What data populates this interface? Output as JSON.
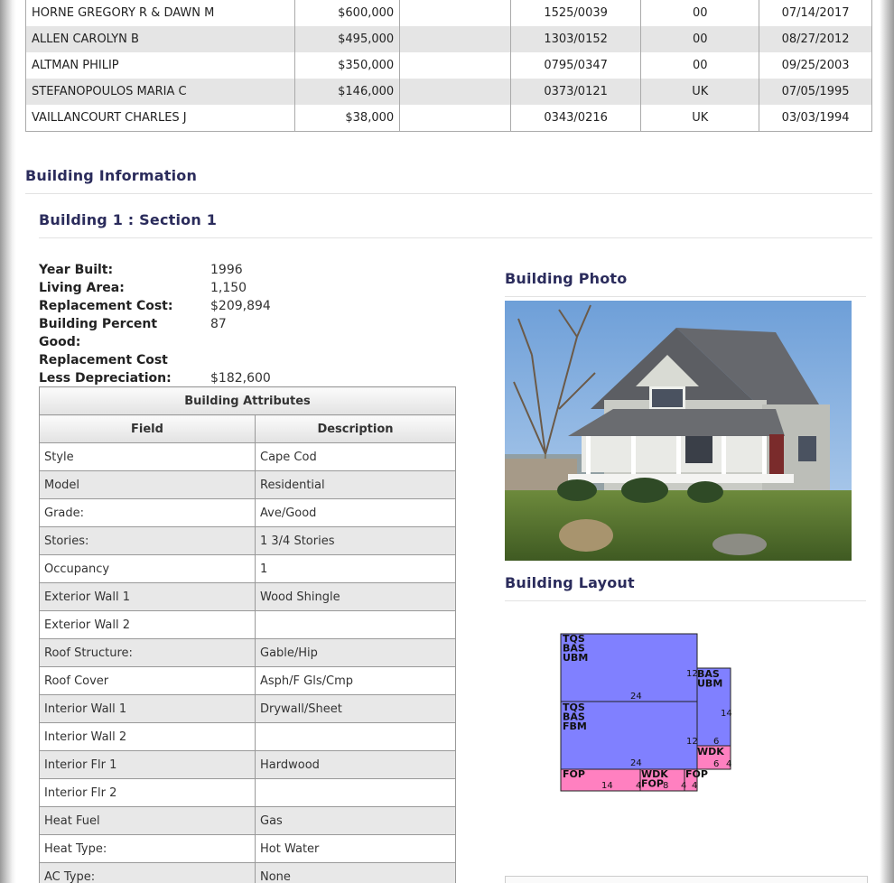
{
  "sales": [
    {
      "owner": "HORNE GREGORY R & DAWN M",
      "price": "$600,000",
      "book_page": "1525/0039",
      "code": "00",
      "date": "07/14/2017"
    },
    {
      "owner": "ALLEN CAROLYN B",
      "price": "$495,000",
      "book_page": "1303/0152",
      "code": "00",
      "date": "08/27/2012"
    },
    {
      "owner": "ALTMAN PHILIP",
      "price": "$350,000",
      "book_page": "0795/0347",
      "code": "00",
      "date": "09/25/2003"
    },
    {
      "owner": "STEFANOPOULOS MARIA C",
      "price": "$146,000",
      "book_page": "0373/0121",
      "code": "UK",
      "date": "07/05/1995"
    },
    {
      "owner": "VAILLANCOURT CHARLES J",
      "price": "$38,000",
      "book_page": "0343/0216",
      "code": "UK",
      "date": "03/03/1994"
    }
  ],
  "building_info": {
    "title": "Building Information",
    "section_title": "Building 1 : Section 1",
    "year_built_label": "Year Built:",
    "year_built": "1996",
    "living_area_label": "Living Area:",
    "living_area": "1,150",
    "replacement_cost_label": "Replacement Cost:",
    "replacement_cost": "$209,894",
    "pct_good_label_1": "Building Percent",
    "pct_good_label_2": "Good:",
    "pct_good": "87",
    "rcld_label_1": "Replacement Cost",
    "rcld_label_2": "Less Depreciation:",
    "rcld": "$182,600"
  },
  "attributes": {
    "title": "Building Attributes",
    "col_field": "Field",
    "col_desc": "Description",
    "rows": [
      {
        "field": "Style",
        "desc": "Cape Cod"
      },
      {
        "field": "Model",
        "desc": "Residential"
      },
      {
        "field": "Grade:",
        "desc": "Ave/Good"
      },
      {
        "field": "Stories:",
        "desc": "1 3/4 Stories"
      },
      {
        "field": "Occupancy",
        "desc": "1"
      },
      {
        "field": "Exterior Wall 1",
        "desc": "Wood Shingle"
      },
      {
        "field": "Exterior Wall 2",
        "desc": ""
      },
      {
        "field": "Roof Structure:",
        "desc": "Gable/Hip"
      },
      {
        "field": "Roof Cover",
        "desc": "Asph/F Gls/Cmp"
      },
      {
        "field": "Interior Wall 1",
        "desc": "Drywall/Sheet"
      },
      {
        "field": "Interior Wall 2",
        "desc": ""
      },
      {
        "field": "Interior Flr 1",
        "desc": "Hardwood"
      },
      {
        "field": "Interior Flr 2",
        "desc": ""
      },
      {
        "field": "Heat Fuel",
        "desc": "Gas"
      },
      {
        "field": "Heat Type:",
        "desc": "Hot Water"
      },
      {
        "field": "AC Type:",
        "desc": "None"
      }
    ]
  },
  "photo": {
    "title": "Building Photo"
  },
  "layout": {
    "title": "Building Layout",
    "labels": {
      "upper_block": "TQS\nBAS\nUBM",
      "middle_block": "TQS\nBAS\nFBM",
      "side_block": "BAS\nUBM",
      "wdk_right": "WDK",
      "fop_left": "FOP",
      "wdk_fop": "WDK\nFOP",
      "fop_right": "FOP",
      "n24a": "24",
      "n12a": "12",
      "n14a": "14",
      "n24b": "24",
      "n12b": "12",
      "n6a": "6",
      "n6b": "6",
      "n4a": "4",
      "n14b": "14",
      "n4b": "4",
      "n8": "8",
      "n4c": "4",
      "n4d": "4"
    },
    "colors": {
      "living": "#8080ff",
      "porch": "#ff80c0"
    }
  }
}
